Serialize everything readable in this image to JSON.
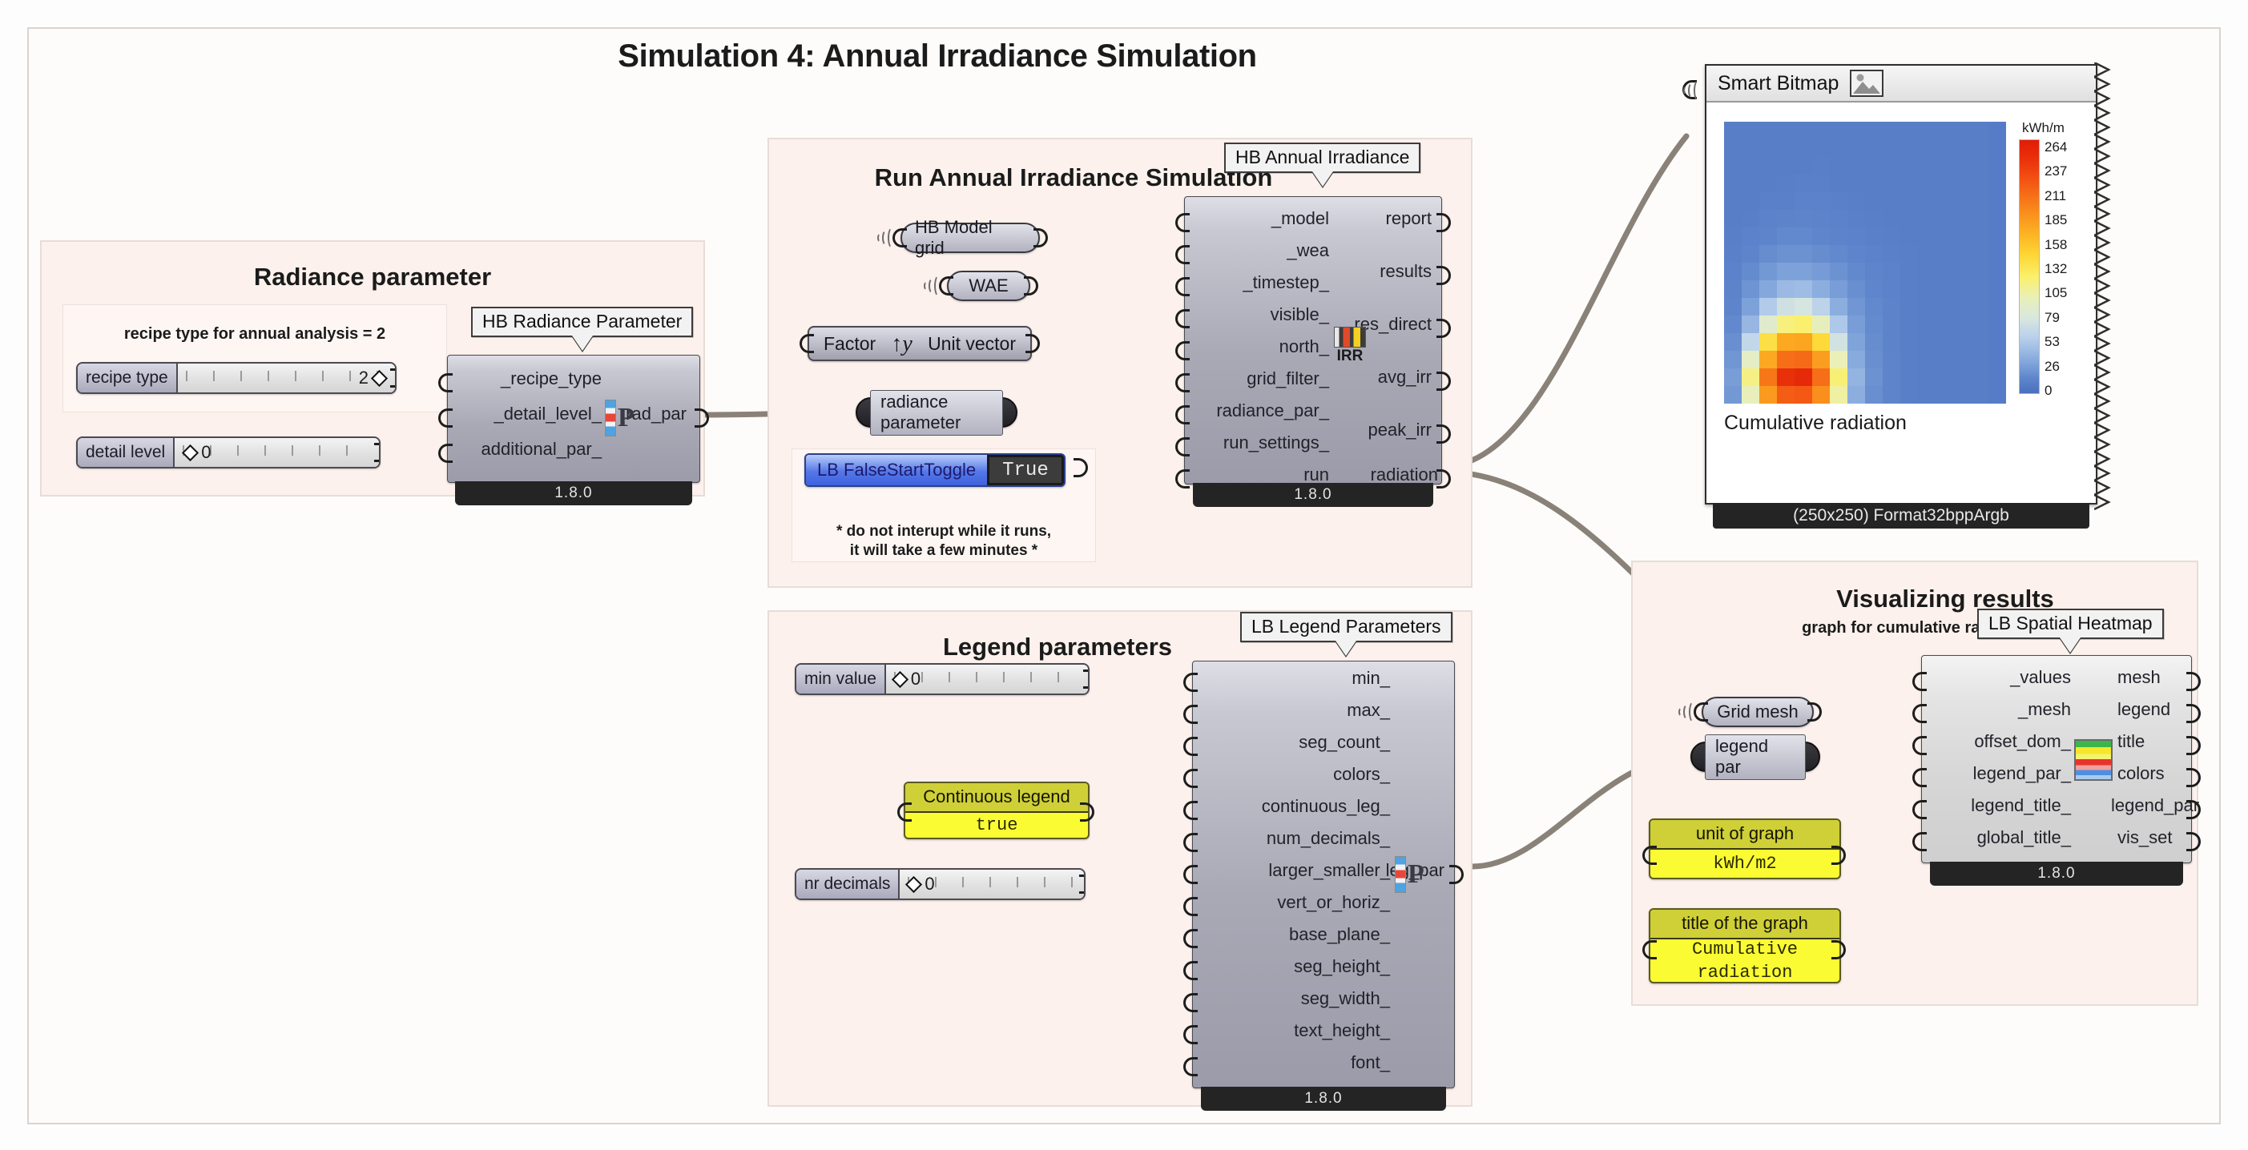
{
  "page": {
    "title": "Simulation 4: Annual Irradiance Simulation"
  },
  "groups": {
    "radiance": {
      "title": "Radiance parameter",
      "note": "recipe type for annual analysis = 2",
      "sliders": [
        {
          "name": "recipe type",
          "value": "2"
        },
        {
          "name": "detail level",
          "value": "0"
        }
      ],
      "node": {
        "balloon": "HB Radiance Parameter",
        "version": "1.8.0",
        "inputs": [
          "_recipe_type",
          "_detail_level_",
          "additional_par_"
        ],
        "outputs": [
          "rad_par"
        ]
      }
    },
    "run_sim": {
      "title": "Run Annual Irradiance Simulation",
      "receivers": [
        "HB Model grid",
        "WAE"
      ],
      "vector_node": {
        "left": "Factor",
        "glyph": "y",
        "right": "Unit vector"
      },
      "relay": "radiance parameter",
      "toggle": {
        "label": "LB FalseStartToggle",
        "value": "True"
      },
      "warning": "* do not interupt while it runs,\nit will take a few minutes *",
      "node": {
        "balloon": "HB Annual Irradiance",
        "version": "1.8.0",
        "inputs": [
          "_model",
          "_wea",
          "_timestep_",
          "visible_",
          "north_",
          "grid_filter_",
          "radiance_par_",
          "run_settings_",
          "_run"
        ],
        "outputs": [
          "report",
          "results",
          "res_direct",
          "avg_irr",
          "peak_irr",
          "radiation"
        ],
        "icon": "irr-icon"
      }
    },
    "legend": {
      "title": "Legend parameters",
      "sliders": [
        {
          "name": "min value",
          "value": "0"
        },
        {
          "name": "nr decimals",
          "value": "0"
        }
      ],
      "panel": {
        "head": "Continuous legend",
        "body": "true"
      },
      "node": {
        "balloon": "LB Legend Parameters",
        "version": "1.8.0",
        "inputs": [
          "min_",
          "max_",
          "seg_count_",
          "colors_",
          "continuous_leg_",
          "num_decimals_",
          "larger_smaller_",
          "vert_or_horiz_",
          "base_plane_",
          "seg_height_",
          "seg_width_",
          "text_height_",
          "font_"
        ],
        "outputs": [
          "leg_par"
        ]
      }
    },
    "visualize": {
      "title": "Visualizing results",
      "subtitle": "graph for cumulative radiation",
      "receiver": "Grid mesh",
      "relay": "legend par",
      "panels": [
        {
          "head": "unit of graph",
          "body": "kWh/m2"
        },
        {
          "head": "title of the graph",
          "body": "Cumulative\nradiation"
        }
      ],
      "node": {
        "balloon": "LB Spatial Heatmap",
        "version": "1.8.0",
        "inputs": [
          "_values",
          "_mesh",
          "offset_dom_",
          "legend_par_",
          "legend_title_",
          "global_title_"
        ],
        "outputs": [
          "mesh",
          "legend",
          "title",
          "colors",
          "legend_par",
          "vis_set"
        ]
      }
    }
  },
  "bitmap": {
    "title": "Smart Bitmap",
    "icon": "image-icon",
    "footer": "(250x250) Format32bppArgb",
    "caption": "Cumulative radiation"
  },
  "chart_data": {
    "type": "heatmap",
    "title": "Cumulative radiation",
    "colorbar_unit": "kWh/m",
    "colorbar_ticks": [
      "264",
      "237",
      "211",
      "185",
      "158",
      "132",
      "105",
      "79",
      "53",
      "26",
      "0"
    ],
    "zlim": [
      0,
      264
    ],
    "colormap": [
      "#4a6fc0",
      "#86aadd",
      "#b9d0ec",
      "#eaf0b7",
      "#fbf06a",
      "#fdd533",
      "#f8821a",
      "#ea2f0a"
    ],
    "grid_size": [
      16,
      16
    ],
    "values": [
      [
        20,
        20,
        20,
        20,
        20,
        20,
        20,
        20,
        20,
        20,
        20,
        20,
        20,
        20,
        20,
        18
      ],
      [
        20,
        20,
        20,
        20,
        20,
        20,
        20,
        20,
        20,
        20,
        20,
        20,
        20,
        20,
        20,
        18
      ],
      [
        20,
        20,
        20,
        20,
        20,
        22,
        20,
        20,
        20,
        20,
        20,
        20,
        20,
        20,
        20,
        18
      ],
      [
        20,
        20,
        20,
        22,
        24,
        24,
        20,
        20,
        20,
        20,
        20,
        20,
        20,
        20,
        20,
        18
      ],
      [
        20,
        20,
        24,
        24,
        26,
        26,
        24,
        22,
        20,
        20,
        20,
        20,
        20,
        20,
        20,
        18
      ],
      [
        20,
        22,
        26,
        28,
        30,
        28,
        26,
        24,
        22,
        20,
        20,
        20,
        20,
        20,
        20,
        18
      ],
      [
        22,
        26,
        30,
        34,
        34,
        32,
        28,
        26,
        24,
        22,
        20,
        20,
        20,
        20,
        20,
        18
      ],
      [
        24,
        30,
        38,
        42,
        42,
        38,
        34,
        30,
        26,
        24,
        22,
        20,
        20,
        20,
        20,
        18
      ],
      [
        26,
        36,
        48,
        56,
        56,
        50,
        42,
        34,
        30,
        26,
        22,
        20,
        20,
        20,
        20,
        18
      ],
      [
        28,
        44,
        62,
        74,
        76,
        66,
        52,
        40,
        32,
        26,
        22,
        20,
        20,
        20,
        20,
        18
      ],
      [
        30,
        56,
        86,
        104,
        108,
        92,
        66,
        46,
        34,
        28,
        22,
        20,
        20,
        20,
        20,
        18
      ],
      [
        34,
        72,
        120,
        148,
        152,
        128,
        84,
        52,
        36,
        28,
        22,
        20,
        20,
        20,
        20,
        18
      ],
      [
        40,
        96,
        170,
        206,
        208,
        176,
        106,
        58,
        38,
        28,
        22,
        20,
        20,
        20,
        20,
        18
      ],
      [
        46,
        124,
        206,
        236,
        238,
        212,
        132,
        64,
        40,
        30,
        22,
        20,
        20,
        20,
        20,
        18
      ],
      [
        52,
        146,
        232,
        258,
        260,
        236,
        150,
        70,
        42,
        30,
        22,
        20,
        20,
        20,
        20,
        18
      ],
      [
        48,
        130,
        214,
        244,
        246,
        220,
        138,
        66,
        40,
        30,
        22,
        20,
        20,
        20,
        20,
        18
      ]
    ]
  }
}
